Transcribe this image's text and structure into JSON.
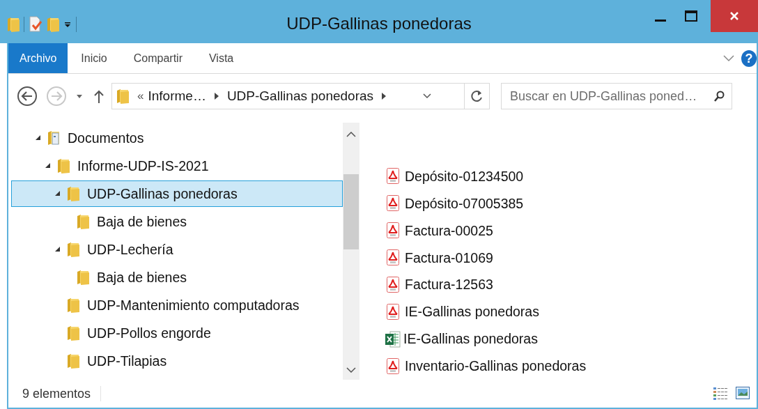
{
  "window": {
    "title": "UDP-Gallinas ponedoras"
  },
  "ribbon": {
    "tabs": [
      {
        "label": "Archivo",
        "selected": true
      },
      {
        "label": "Inicio",
        "selected": false
      },
      {
        "label": "Compartir",
        "selected": false
      },
      {
        "label": "Vista",
        "selected": false
      }
    ],
    "help": "?"
  },
  "navigation": {
    "back_disabled": false,
    "forward_disabled": true
  },
  "address_bar": {
    "overflow": "«",
    "path": [
      "Informe…",
      "UDP-Gallinas ponedoras"
    ]
  },
  "search": {
    "placeholder": "Buscar en UDP-Gallinas poned…"
  },
  "tree": [
    {
      "label": "Documentos",
      "kind": "documents",
      "expanded": true,
      "selected": false,
      "children": [
        {
          "label": "Informe-UDP-IS-2021",
          "kind": "folder",
          "expanded": true,
          "selected": false,
          "children": [
            {
              "label": "UDP-Gallinas ponedoras",
              "kind": "folder",
              "expanded": true,
              "selected": true,
              "children": [
                {
                  "label": "Baja de bienes",
                  "kind": "folder",
                  "selected": false
                }
              ]
            },
            {
              "label": "UDP-Lechería",
              "kind": "folder",
              "expanded": true,
              "selected": false,
              "children": [
                {
                  "label": "Baja de bienes",
                  "kind": "folder",
                  "selected": false
                }
              ]
            },
            {
              "label": "UDP-Mantenimiento computadoras",
              "kind": "folder",
              "selected": false
            },
            {
              "label": "UDP-Pollos engorde",
              "kind": "folder",
              "selected": false
            },
            {
              "label": "UDP-Tilapias",
              "kind": "folder",
              "selected": false
            }
          ]
        }
      ]
    }
  ],
  "files": [
    {
      "name": "Depósito-01234500",
      "kind": "pdf"
    },
    {
      "name": "Depósito-07005385",
      "kind": "pdf"
    },
    {
      "name": "Factura-00025",
      "kind": "pdf"
    },
    {
      "name": "Factura-01069",
      "kind": "pdf"
    },
    {
      "name": "Factura-12563",
      "kind": "pdf"
    },
    {
      "name": "IE-Gallinas ponedoras",
      "kind": "pdf"
    },
    {
      "name": "IE-Gallinas ponedoras",
      "kind": "excel"
    },
    {
      "name": "Inventario-Gallinas ponedoras",
      "kind": "pdf"
    }
  ],
  "status_bar": {
    "item_count": "9 elementos"
  }
}
